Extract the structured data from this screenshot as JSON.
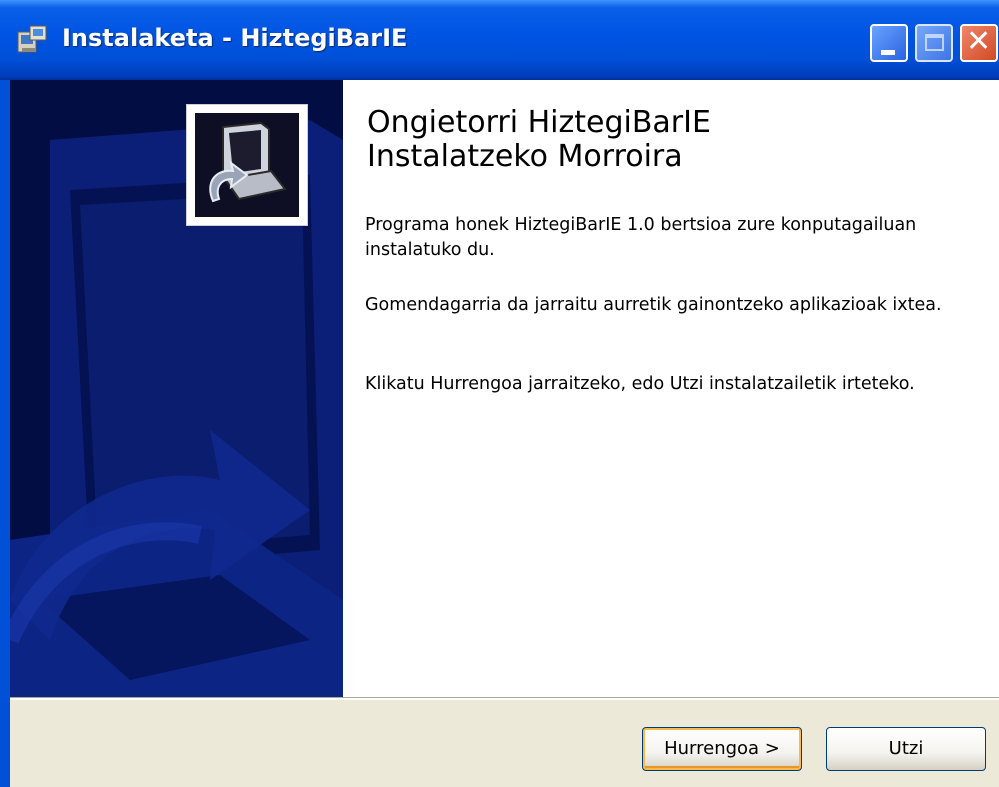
{
  "window": {
    "title": "Instalaketa - HiztegiBarIE",
    "icons": {
      "title_icon": "installer-icon",
      "minimize": "minimize-icon",
      "maximize": "maximize-icon",
      "close": "close-icon",
      "banner": "setup-computer-icon"
    },
    "close_glyph": "✕"
  },
  "content": {
    "heading_line1": "Ongietorri HiztegiBarIE",
    "heading_line2": "Instalatzeko Morroira",
    "paragraph1": "Programa honek HiztegiBarIE 1.0 bertsioa zure konputagailuan instalatuko du.",
    "paragraph2": "Gomendagarria da jarraitu aurretik gainontzeko aplikazioak ixtea.",
    "paragraph3": "Klikatu Hurrengoa jarraitzeko, edo Utzi instalatzailetik irteteko."
  },
  "buttons": {
    "next_label": "Hurrengoa >",
    "cancel_label": "Utzi"
  },
  "colors": {
    "titlebar": "#0054e3",
    "banner": "#02114f",
    "footer": "#ece9d8",
    "default_button_highlight": "#f9b94b"
  }
}
